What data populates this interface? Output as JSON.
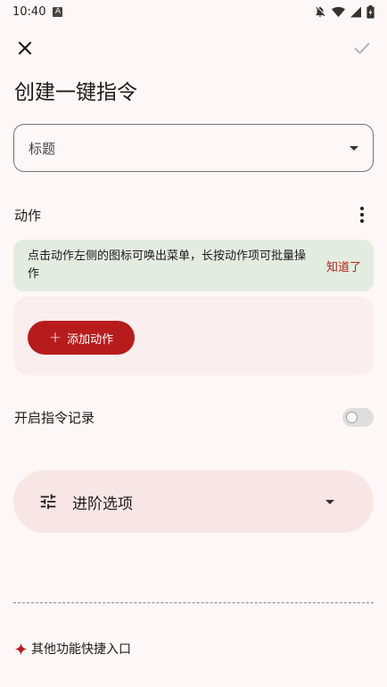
{
  "status_bar": {
    "time": "10:40",
    "notification_icon_letter": "A"
  },
  "header": {
    "title": "创建一键指令"
  },
  "title_field": {
    "label": "标题"
  },
  "actions_section": {
    "label": "动作"
  },
  "tip": {
    "text": "点击动作左侧的图标可唤出菜单，长按动作项可批量操作",
    "dismiss_label": "知道了"
  },
  "add_action": {
    "label": "添加动作"
  },
  "record": {
    "label": "开启指令记录",
    "enabled": false
  },
  "advanced": {
    "label": "进阶选项"
  },
  "shortcut": {
    "label": "其他功能快捷入口"
  },
  "colors": {
    "accent": "#b71c1c",
    "background": "#fef7f7",
    "tip_background": "#e3ece1",
    "panel_background": "#faeeee",
    "advanced_background": "#f8e5e5"
  }
}
